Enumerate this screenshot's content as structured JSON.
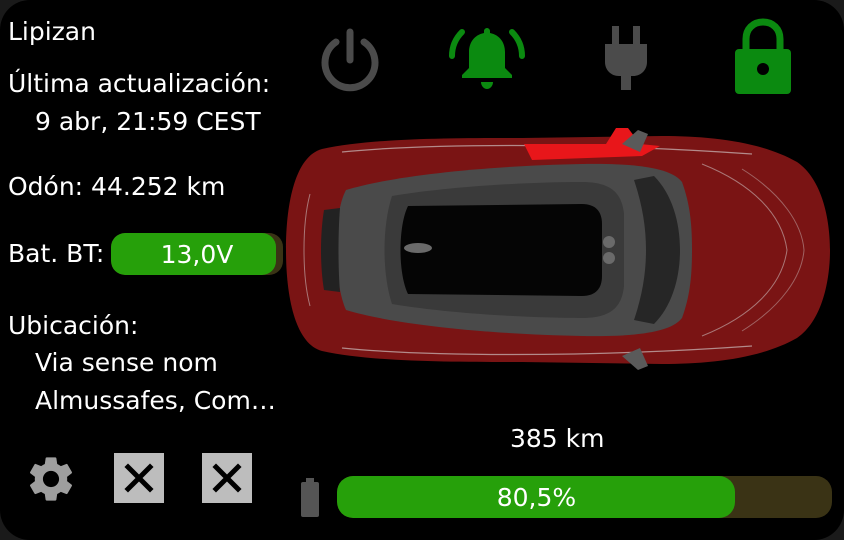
{
  "vehicle": {
    "name": "Lipizan"
  },
  "update": {
    "label": "Última actualización:",
    "value": "9 abr, 21:59 CEST"
  },
  "odometer": {
    "text": "Odón: 44.252 km"
  },
  "battery12v": {
    "label": "Bat. BT:",
    "value": "13,0V",
    "level": 0.96
  },
  "location": {
    "label": "Ubicación:",
    "line1": "Via sense nom",
    "line2": "Almussafes, Com…"
  },
  "range": {
    "text": "385 km"
  },
  "charge": {
    "value": "80,5%",
    "level": 0.805
  },
  "status_icons": [
    {
      "name": "power-icon",
      "active": false
    },
    {
      "name": "alarm-bell-icon",
      "active": true
    },
    {
      "name": "plug-icon",
      "active": false
    },
    {
      "name": "lock-icon",
      "active": true
    }
  ],
  "colors": {
    "active": "#0b8a10",
    "inactive": "#4b4b4b",
    "bar_fill": "#26a00a",
    "bar_track": "#3a3315",
    "car_body": "#7a1414"
  }
}
